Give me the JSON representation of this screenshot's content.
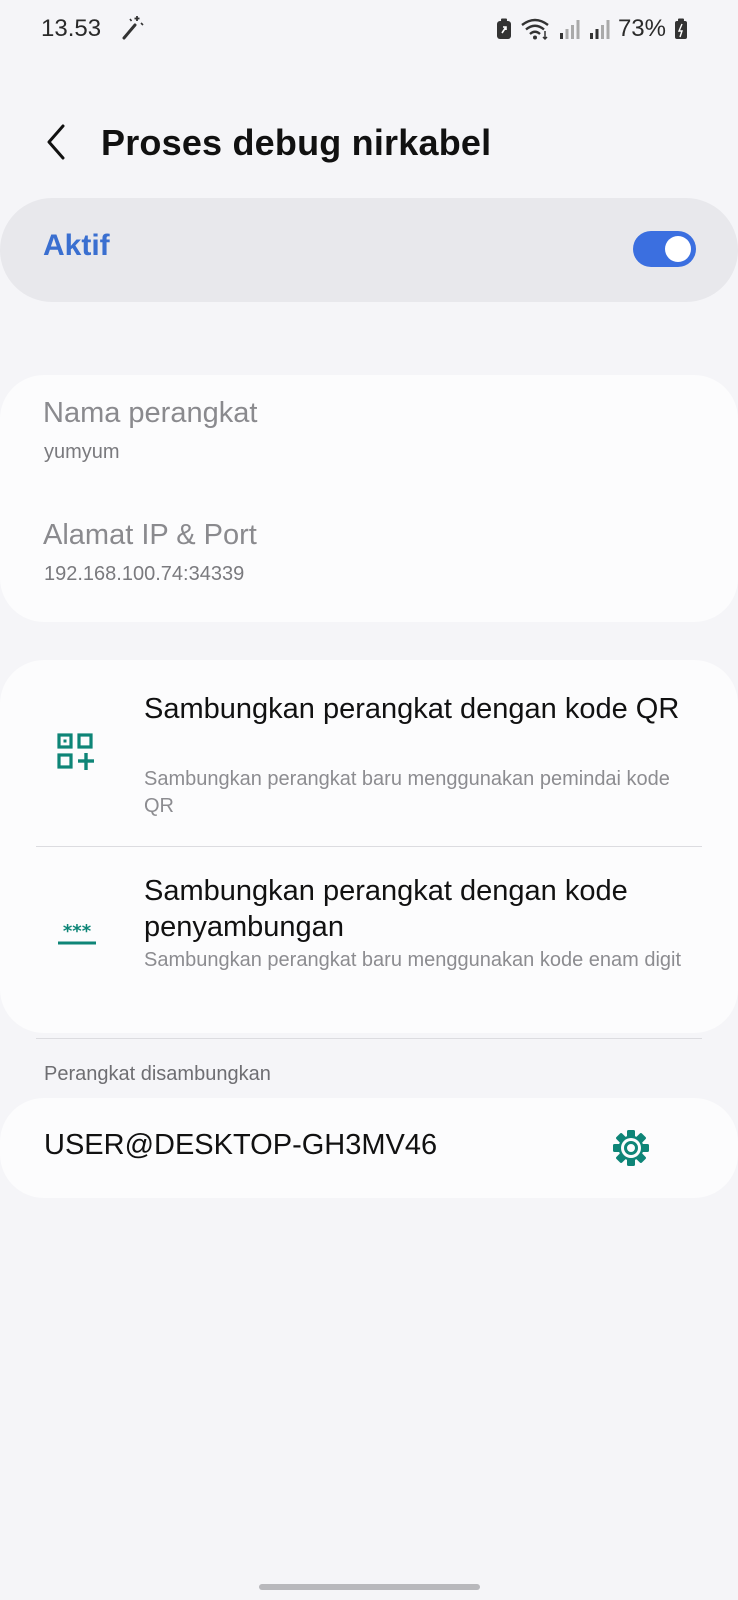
{
  "status_bar": {
    "time": "13.53",
    "battery_percent": "73%",
    "icons": [
      "magic-wand-icon",
      "battery-saver-icon",
      "wifi-icon",
      "signal-icon",
      "signal-icon",
      "battery-icon"
    ]
  },
  "header": {
    "back_icon": "chevron-left-icon",
    "title": "Proses debug nirkabel"
  },
  "main_switch": {
    "label": "Aktif",
    "checked": true,
    "color": "#3b6fe0"
  },
  "device_info": {
    "name_label": "Nama perangkat",
    "name_value": "yumyum",
    "ip_label": "Alamat IP & Port",
    "ip_value": "192.168.100.74:34339"
  },
  "pairing": {
    "qr": {
      "icon": "qr-code-add-icon",
      "title": "Sambungkan perangkat dengan kode QR",
      "subtitle": "Sambungkan perangkat baru menggunakan pemindai kode QR"
    },
    "code": {
      "icon": "password-icon",
      "title": "Sambungkan perangkat dengan kode penyambungan",
      "subtitle": "Sambungkan perangkat baru menggunakan kode enam digit"
    }
  },
  "paired_devices": {
    "header": "Perangkat disambungkan",
    "items": [
      {
        "name": "USER@DESKTOP-GH3MV46",
        "icon": "gear-icon"
      }
    ]
  },
  "accent_teal": "#0e8577"
}
